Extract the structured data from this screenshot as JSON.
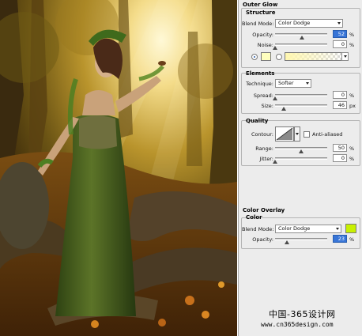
{
  "outer_glow": {
    "header": "Outer Glow",
    "structure": {
      "title": "Structure",
      "blend_mode_label": "Blend Mode:",
      "blend_mode_value": "Color Dodge",
      "opacity_label": "Opacity:",
      "opacity_value": "52",
      "opacity_unit": "%",
      "opacity_level": 0.52,
      "noise_label": "Noise:",
      "noise_value": "0",
      "noise_unit": "%",
      "noise_level": 0,
      "color_swatch": "#ffffbe",
      "gradient_start": "#fff7b0",
      "gradient_end": "transparent"
    },
    "elements": {
      "title": "Elements",
      "technique_label": "Technique:",
      "technique_value": "Softer",
      "spread_label": "Spread:",
      "spread_value": "0",
      "spread_unit": "%",
      "spread_level": 0,
      "size_label": "Size:",
      "size_value": "46",
      "size_unit": "px",
      "size_level": 0.18
    },
    "quality": {
      "title": "Quality",
      "contour_label": "Contour:",
      "anti_aliased_label": "Anti-aliased",
      "anti_aliased_checked": false,
      "range_label": "Range:",
      "range_value": "50",
      "range_unit": "%",
      "range_level": 0.5,
      "jitter_label": "Jitter:",
      "jitter_value": "0",
      "jitter_unit": "%",
      "jitter_level": 0
    }
  },
  "color_overlay": {
    "header": "Color Overlay",
    "color": {
      "title": "Color",
      "blend_mode_label": "Blend Mode:",
      "blend_mode_value": "Color Dodge",
      "color_swatch": "#c8f000",
      "opacity_label": "Opacity:",
      "opacity_value": "23",
      "opacity_unit": "%",
      "opacity_level": 0.23
    }
  },
  "watermark": {
    "line1": "中国-365设计网",
    "line2": "www.cn365design.com"
  },
  "icons": [
    "blend-mode-dropdown-arrow-icon",
    "slider-thumb-icon",
    "contour-curve-icon"
  ]
}
